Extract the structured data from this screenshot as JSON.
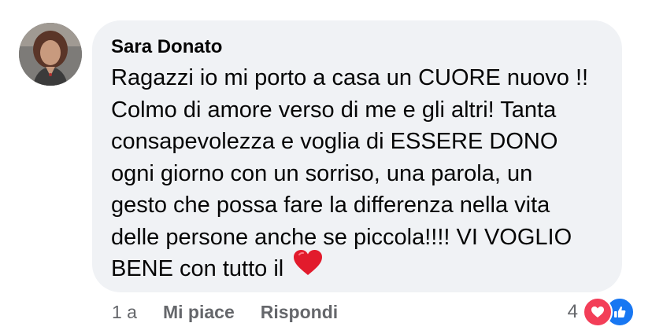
{
  "comment": {
    "author": "Sara Donato",
    "text_lines": [
      "Ragazzi io mi porto a casa un CUORE nuovo !!",
      "Colmo di amore verso di me e gli altri! Tanta",
      "consapevolezza e voglia di ESSERE DONO",
      "ogni giorno con un sorriso, una parola, un",
      "gesto che possa fare la differenza nella vita",
      "delle persone anche se piccola!!!! VI VOGLIO",
      "BENE con tutto il"
    ],
    "emoji_icon": "red-heart-emoji"
  },
  "actions": {
    "time": "1 a",
    "like_label": "Mi piace",
    "reply_label": "Rispondi"
  },
  "reactions": {
    "count": "4",
    "icons": [
      "love-reaction-icon",
      "like-reaction-icon"
    ],
    "colors": {
      "love": "#f33e58",
      "like": "#1877f2"
    }
  },
  "colors": {
    "bubble": "#f0f2f5",
    "text": "#050505",
    "secondary": "#65676b"
  }
}
